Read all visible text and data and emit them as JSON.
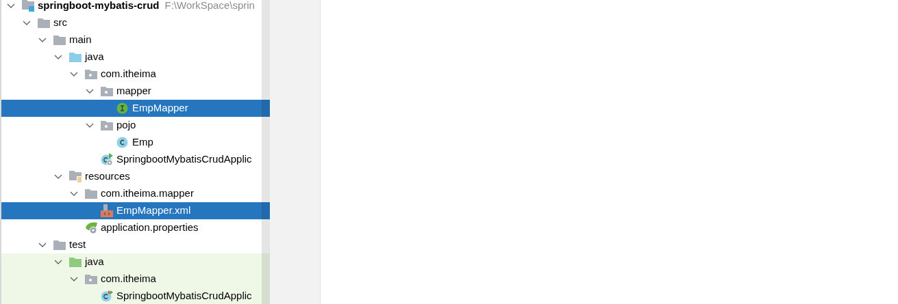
{
  "project_tree": [
    {
      "kind": "module",
      "label": "springboot-mybatis-crud",
      "path": "F:\\WorkSpace\\sprin",
      "expanded": true,
      "selected": false,
      "children": [
        {
          "kind": "folder",
          "label": "src",
          "expanded": true,
          "selected": false,
          "children": [
            {
              "kind": "folder",
              "label": "main",
              "expanded": true,
              "selected": false,
              "children": [
                {
                  "kind": "source-folder",
                  "label": "java",
                  "expanded": true,
                  "selected": false,
                  "children": [
                    {
                      "kind": "package",
                      "label": "com.itheima",
                      "expanded": true,
                      "selected": false,
                      "children": [
                        {
                          "kind": "package",
                          "label": "mapper",
                          "expanded": true,
                          "selected": false,
                          "children": [
                            {
                              "kind": "interface",
                              "label": "EmpMapper",
                              "selected": true
                            }
                          ]
                        },
                        {
                          "kind": "package",
                          "label": "pojo",
                          "expanded": true,
                          "selected": false,
                          "children": [
                            {
                              "kind": "class",
                              "label": "Emp",
                              "selected": false
                            }
                          ]
                        },
                        {
                          "kind": "spring-app",
                          "label": "SpringbootMybatisCrudApplic",
                          "selected": false
                        }
                      ]
                    }
                  ]
                },
                {
                  "kind": "resources",
                  "label": "resources",
                  "expanded": true,
                  "selected": false,
                  "children": [
                    {
                      "kind": "folder",
                      "label": "com.itheima.mapper",
                      "expanded": true,
                      "selected": false,
                      "children": [
                        {
                          "kind": "xml",
                          "label": "EmpMapper.xml",
                          "selected": true
                        }
                      ]
                    },
                    {
                      "kind": "properties",
                      "label": "application.properties",
                      "selected": false
                    }
                  ]
                }
              ]
            },
            {
              "kind": "folder",
              "label": "test",
              "expanded": true,
              "selected": false,
              "children": [
                {
                  "kind": "test-source-folder",
                  "label": "java",
                  "expanded": true,
                  "selected": false,
                  "children": [
                    {
                      "kind": "package",
                      "label": "com.itheima",
                      "expanded": true,
                      "selected": false,
                      "children": [
                        {
                          "kind": "test-class",
                          "label": "SpringbootMybatisCrudApplic",
                          "selected": false
                        }
                      ]
                    }
                  ]
                }
              ]
            }
          ]
        }
      ]
    }
  ]
}
